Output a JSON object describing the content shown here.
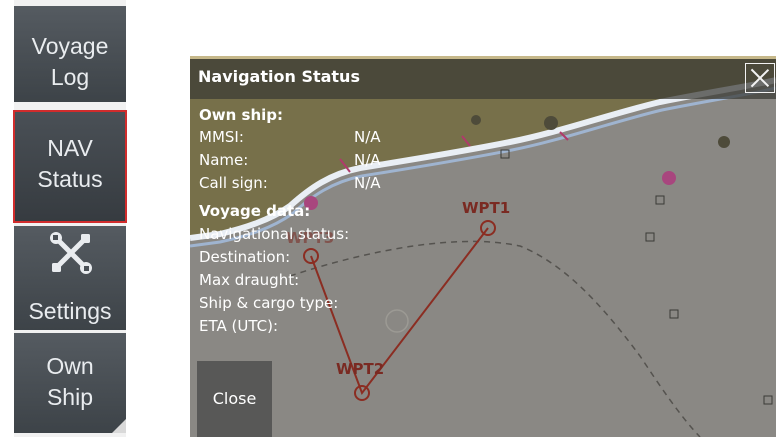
{
  "side_menu": {
    "voyage_log": {
      "line1": "Voyage",
      "line2": "Log"
    },
    "nav_status": {
      "line1": "NAV",
      "line2": "Status"
    },
    "settings": {
      "label": "Settings",
      "icon": "wrench-screwdriver-icon"
    },
    "own_ship": {
      "line1": "Own",
      "line2": "Ship"
    }
  },
  "dialog": {
    "title": "Navigation Status",
    "close_x_icon": "close-icon",
    "own_ship": {
      "heading": "Own ship:",
      "rows": [
        {
          "label": "MMSI:",
          "value": "N/A"
        },
        {
          "label": "Name:",
          "value": "N/A"
        },
        {
          "label": "Call sign:",
          "value": "N/A"
        }
      ]
    },
    "voyage": {
      "heading": "Voyage data:",
      "rows": [
        {
          "label": "Navigational status:"
        },
        {
          "label": "Destination:"
        },
        {
          "label": "Max draught:"
        },
        {
          "label": "Ship & cargo type:"
        },
        {
          "label": "ETA (UTC):"
        }
      ]
    },
    "close_button": "Close"
  },
  "chart": {
    "waypoints": [
      "WPT1",
      "WPT2",
      "WPT3"
    ]
  },
  "colors": {
    "highlight": "#d12c2c",
    "route": "#8b2d22",
    "land": "#7a6e4a",
    "water": "#8a8884"
  }
}
